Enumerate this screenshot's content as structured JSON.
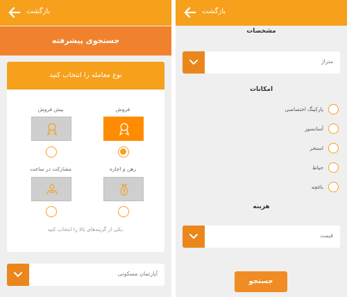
{
  "back_label": "بازگشت",
  "left": {
    "page_title": "جستجوی پیشرفته",
    "card_title": "نوع معامله را انتخاب کنید",
    "options": [
      {
        "label": "فروش",
        "icon": "medal-icon",
        "selected": true
      },
      {
        "label": "پیش فروش",
        "icon": "medal-icon",
        "selected": false
      },
      {
        "label": "رهن و اجاره",
        "icon": "money-bag-icon",
        "selected": false
      },
      {
        "label": "مشارکت در ساخت",
        "icon": "handshake-icon",
        "selected": false
      }
    ],
    "hint": "یکی از گزینه‌های بالا را انتخاب کنید.",
    "property_type": "آپارتمان مسکونی"
  },
  "right": {
    "specs_title": "مشخصات",
    "area_value": "متراژ",
    "amenities_title": "امکانات",
    "amenities": [
      {
        "label": "پارکینگ اختصاصی"
      },
      {
        "label": "آسانسور"
      },
      {
        "label": "استخر"
      },
      {
        "label": "حیاط"
      },
      {
        "label": "باغچه"
      }
    ],
    "cost_title": "هزینه",
    "price_value": "قیمت",
    "search_button": "جستجو"
  },
  "colors": {
    "topbar": "#f6a01b",
    "title_bar": "#f0822e",
    "accent": "#ea861c",
    "selected_tile": "#ff8c00"
  }
}
